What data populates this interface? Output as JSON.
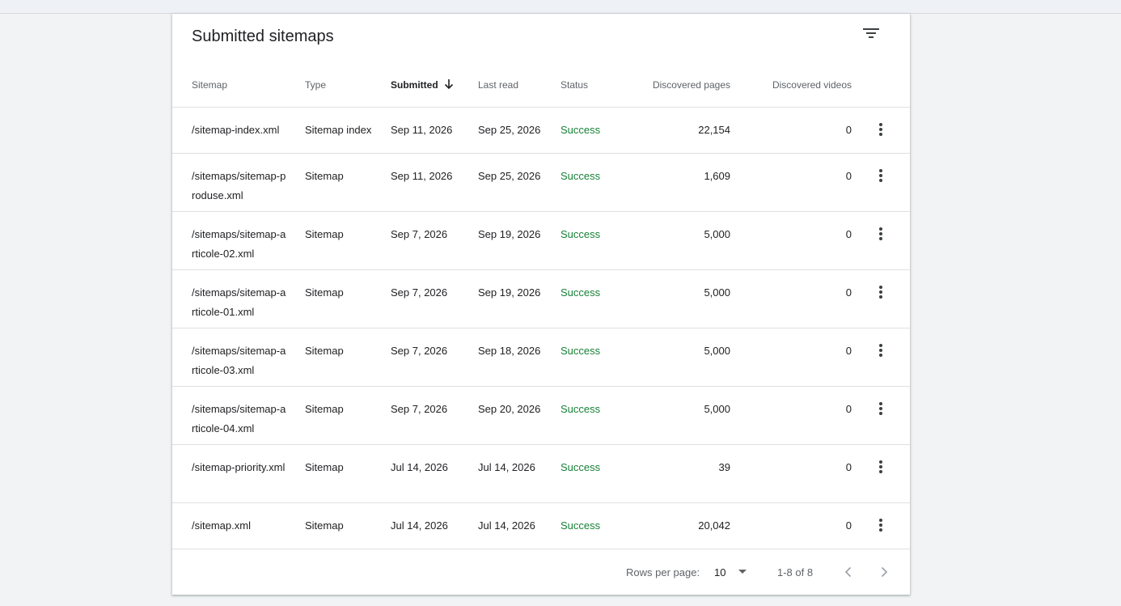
{
  "card": {
    "title": "Submitted sitemaps",
    "filter_icon": "filter-list-icon"
  },
  "columns": {
    "sitemap": "Sitemap",
    "type": "Type",
    "submitted": "Submitted",
    "last_read": "Last read",
    "status": "Status",
    "discovered_pages": "Discovered pages",
    "discovered_videos": "Discovered videos",
    "sort_icon": "arrow-downward-icon"
  },
  "rows": [
    {
      "sitemap": "/sitemap-index.xml",
      "type": "Sitemap index",
      "submitted": "Sep 11, 2026",
      "last_read": "Sep 25, 2026",
      "status": "Success",
      "pages": "22,154",
      "videos": "0"
    },
    {
      "sitemap": "/sitemaps/sitemap-produse.xml",
      "type": "Sitemap",
      "submitted": "Sep 11, 2026",
      "last_read": "Sep 25, 2026",
      "status": "Success",
      "pages": "1,609",
      "videos": "0"
    },
    {
      "sitemap": "/sitemaps/sitemap-articole-02.xml",
      "type": "Sitemap",
      "submitted": "Sep 7, 2026",
      "last_read": "Sep 19, 2026",
      "status": "Success",
      "pages": "5,000",
      "videos": "0"
    },
    {
      "sitemap": "/sitemaps/sitemap-articole-01.xml",
      "type": "Sitemap",
      "submitted": "Sep 7, 2026",
      "last_read": "Sep 19, 2026",
      "status": "Success",
      "pages": "5,000",
      "videos": "0"
    },
    {
      "sitemap": "/sitemaps/sitemap-articole-03.xml",
      "type": "Sitemap",
      "submitted": "Sep 7, 2026",
      "last_read": "Sep 18, 2026",
      "status": "Success",
      "pages": "5,000",
      "videos": "0"
    },
    {
      "sitemap": "/sitemaps/sitemap-articole-04.xml",
      "type": "Sitemap",
      "submitted": "Sep 7, 2026",
      "last_read": "Sep 20, 2026",
      "status": "Success",
      "pages": "5,000",
      "videos": "0"
    },
    {
      "sitemap": "/sitemap-priority.xml",
      "type": "Sitemap",
      "submitted": "Jul 14, 2026",
      "last_read": "Jul 14, 2026",
      "status": "Success",
      "pages": "39",
      "videos": "0"
    },
    {
      "sitemap": "/sitemap.xml",
      "type": "Sitemap",
      "submitted": "Jul 14, 2026",
      "last_read": "Jul 14, 2026",
      "status": "Success",
      "pages": "20,042",
      "videos": "0"
    }
  ],
  "row_menu_icon": "more-vert-icon",
  "footer": {
    "rows_per_page_label": "Rows per page:",
    "rows_per_page_value": "10",
    "range_text": "1-8 of 8",
    "prev_icon": "chevron-left-icon",
    "next_icon": "chevron-right-icon"
  },
  "colors": {
    "status_success": "#188038",
    "background": "#f1f3f4",
    "card": "#ffffff"
  }
}
